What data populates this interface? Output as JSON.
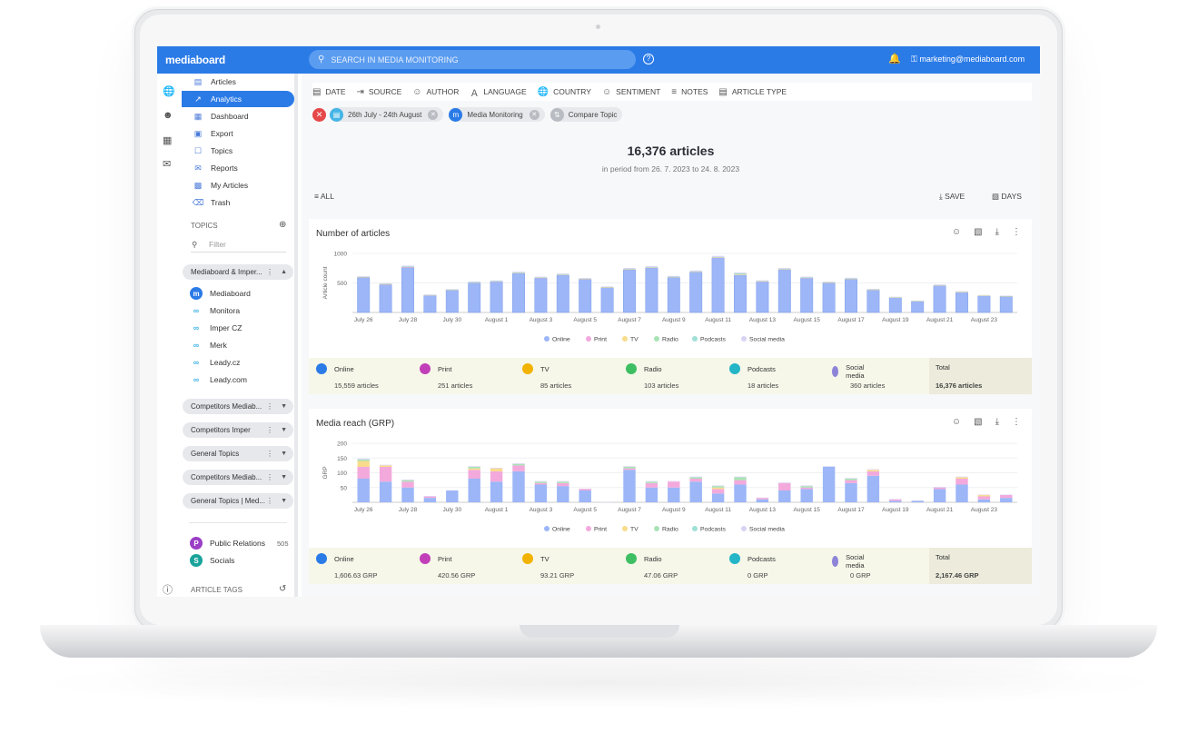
{
  "app": {
    "logo": "mediaboard",
    "search_placeholder": "SEARCH IN MEDIA MONITORING",
    "user": "marketing@mediaboard.com",
    "help": "?"
  },
  "nav": [
    {
      "label": "Articles",
      "icon": "articles-icon"
    },
    {
      "label": "Analytics",
      "icon": "analytics-icon",
      "active": true
    },
    {
      "label": "Dashboard",
      "icon": "dashboard-icon"
    },
    {
      "label": "Export",
      "icon": "export-icon"
    },
    {
      "label": "Topics",
      "icon": "topics-icon"
    },
    {
      "label": "Reports",
      "icon": "reports-icon"
    },
    {
      "label": "My Articles",
      "icon": "my-articles-icon"
    },
    {
      "label": "Trash",
      "icon": "trash-icon"
    }
  ],
  "topics": {
    "heading": "TOPICS",
    "filter_placeholder": "Filter",
    "groups": [
      "Mediaboard & Imper...",
      "Competitors Mediab...",
      "Competitors Imper",
      "General Topics",
      "Competitors Mediab...",
      "General Topics | Med..."
    ],
    "group_items": [
      "Mediaboard",
      "Monitora",
      "Imper CZ",
      "Merk",
      "Leady.cz",
      "Leady.com"
    ],
    "tags": [
      {
        "badge": "P",
        "label": "Public Relations",
        "count": "505",
        "color": "#9b3fc6"
      },
      {
        "badge": "S",
        "label": "Socials",
        "count": "",
        "color": "#1aa39a"
      }
    ],
    "article_tags": "ARTICLE TAGS"
  },
  "filters": [
    "DATE",
    "SOURCE",
    "AUTHOR",
    "LANGUAGE",
    "COUNTRY",
    "SENTIMENT",
    "NOTES",
    "ARTICLE TYPE"
  ],
  "chips": [
    {
      "label": "26th July - 24th August"
    },
    {
      "label": "Media Monitoring"
    },
    {
      "label": "Compare Topic"
    }
  ],
  "summary": {
    "count": "16,376 articles",
    "period": "in period from 26. 7. 2023 to 24. 8. 2023"
  },
  "toolbar": {
    "all": "ALL",
    "save": "SAVE",
    "days": "DAYS"
  },
  "colors": {
    "accent": "#2b7be7",
    "online": "#9cb6f7",
    "print": "#f3a9dc",
    "tv": "#f8dc8c",
    "radio": "#a9e3b5",
    "podcasts": "#9fe0d6",
    "social": "#d9d2f4"
  },
  "legend": [
    "Online",
    "Print",
    "TV",
    "Radio",
    "Podcasts",
    "Social media"
  ],
  "chart_data": [
    {
      "type": "bar",
      "title": "Number of articles",
      "ylabel": "Article count",
      "ylim": [
        0,
        1000
      ],
      "yticks": [
        "1000",
        "500"
      ],
      "x_tick_labels": [
        "July 26",
        "July 28",
        "July 30",
        "August 1",
        "August 3",
        "August 5",
        "August 7",
        "August 9",
        "August 11",
        "August 13",
        "August 15",
        "August 17",
        "August 19",
        "August 21",
        "August 23"
      ],
      "series": [
        {
          "name": "Online",
          "values": [
            590,
            470,
            760,
            290,
            380,
            500,
            520,
            660,
            580,
            630,
            560,
            420,
            720,
            750,
            590,
            680,
            920,
            630,
            520,
            720,
            580,
            500,
            560,
            380,
            250,
            190,
            450,
            340,
            280,
            270
          ]
        },
        {
          "name": "Print",
          "values": [
            8,
            8,
            10,
            4,
            4,
            6,
            6,
            8,
            8,
            7,
            6,
            5,
            9,
            9,
            8,
            8,
            10,
            8,
            6,
            9,
            7,
            6,
            7,
            5,
            4,
            3,
            6,
            5,
            4,
            4
          ]
        },
        {
          "name": "TV",
          "values": [
            3,
            3,
            4,
            2,
            2,
            3,
            3,
            3,
            3,
            3,
            3,
            2,
            4,
            4,
            3,
            3,
            4,
            3,
            3,
            4,
            3,
            3,
            3,
            2,
            2,
            1,
            3,
            2,
            2,
            2
          ]
        },
        {
          "name": "Radio",
          "values": [
            3,
            3,
            4,
            2,
            2,
            3,
            3,
            4,
            3,
            4,
            3,
            3,
            4,
            4,
            4,
            4,
            5,
            20,
            4,
            4,
            4,
            3,
            4,
            3,
            2,
            2,
            3,
            3,
            2,
            2
          ]
        },
        {
          "name": "Podcasts",
          "values": [
            0,
            0,
            1,
            0,
            0,
            1,
            1,
            1,
            0,
            1,
            0,
            0,
            1,
            1,
            1,
            1,
            1,
            1,
            0,
            1,
            1,
            0,
            1,
            0,
            0,
            0,
            1,
            0,
            0,
            0
          ]
        },
        {
          "name": "Social media",
          "values": [
            10,
            10,
            15,
            5,
            8,
            12,
            10,
            15,
            12,
            14,
            12,
            10,
            15,
            15,
            12,
            15,
            18,
            14,
            12,
            15,
            12,
            10,
            12,
            10,
            8,
            6,
            12,
            10,
            8,
            8
          ]
        }
      ],
      "totals": [
        {
          "label": "Online",
          "value": "15,559 articles"
        },
        {
          "label": "Print",
          "value": "251 articles"
        },
        {
          "label": "TV",
          "value": "85 articles"
        },
        {
          "label": "Radio",
          "value": "103 articles"
        },
        {
          "label": "Podcasts",
          "value": "18 articles"
        },
        {
          "label": "Social media",
          "value": "360 articles"
        },
        {
          "label": "Total",
          "value": "16,376 articles"
        }
      ]
    },
    {
      "type": "bar",
      "title": "Media reach (GRP)",
      "ylabel": "GRP",
      "ylim": [
        0,
        200
      ],
      "yticks": [
        "200",
        "150",
        "100",
        "50"
      ],
      "x_tick_labels": [
        "July 26",
        "July 28",
        "July 30",
        "August 1",
        "August 3",
        "August 5",
        "August 7",
        "August 9",
        "August 11",
        "August 13",
        "August 15",
        "August 17",
        "August 19",
        "August 21",
        "August 23"
      ],
      "series": [
        {
          "name": "Online",
          "values": [
            80,
            70,
            50,
            15,
            40,
            80,
            70,
            105,
            60,
            55,
            40,
            0,
            110,
            50,
            50,
            70,
            30,
            60,
            10,
            40,
            45,
            120,
            65,
            90,
            5,
            5,
            45,
            60,
            10,
            15
          ]
        },
        {
          "name": "Print",
          "values": [
            40,
            50,
            20,
            5,
            0,
            30,
            35,
            20,
            5,
            10,
            5,
            0,
            5,
            15,
            20,
            10,
            15,
            15,
            5,
            25,
            5,
            0,
            10,
            15,
            5,
            0,
            5,
            20,
            10,
            10
          ]
        },
        {
          "name": "TV",
          "values": [
            20,
            5,
            0,
            0,
            0,
            5,
            10,
            0,
            0,
            0,
            0,
            0,
            0,
            0,
            0,
            0,
            5,
            0,
            0,
            0,
            0,
            0,
            0,
            5,
            0,
            0,
            0,
            5,
            5,
            0
          ]
        },
        {
          "name": "Radio",
          "values": [
            5,
            0,
            5,
            0,
            0,
            5,
            0,
            5,
            5,
            5,
            0,
            0,
            5,
            5,
            0,
            5,
            5,
            10,
            0,
            0,
            5,
            0,
            5,
            0,
            0,
            0,
            0,
            0,
            0,
            0
          ]
        },
        {
          "name": "Podcasts",
          "values": [
            0,
            0,
            0,
            0,
            0,
            0,
            0,
            0,
            0,
            0,
            0,
            0,
            0,
            0,
            0,
            0,
            0,
            0,
            0,
            0,
            0,
            0,
            0,
            0,
            0,
            0,
            0,
            0,
            0,
            0
          ]
        },
        {
          "name": "Social media",
          "values": [
            3,
            2,
            2,
            1,
            1,
            2,
            2,
            2,
            2,
            2,
            1,
            1,
            2,
            2,
            2,
            2,
            2,
            2,
            1,
            2,
            2,
            2,
            2,
            2,
            1,
            1,
            2,
            2,
            1,
            1
          ]
        }
      ],
      "totals": [
        {
          "label": "Online",
          "value": "1,606.63 GRP"
        },
        {
          "label": "Print",
          "value": "420.56 GRP"
        },
        {
          "label": "TV",
          "value": "93.21 GRP"
        },
        {
          "label": "Radio",
          "value": "47.06 GRP"
        },
        {
          "label": "Podcasts",
          "value": "0 GRP"
        },
        {
          "label": "Social media",
          "value": "0 GRP"
        },
        {
          "label": "Total",
          "value": "2,167.46 GRP"
        }
      ]
    }
  ]
}
